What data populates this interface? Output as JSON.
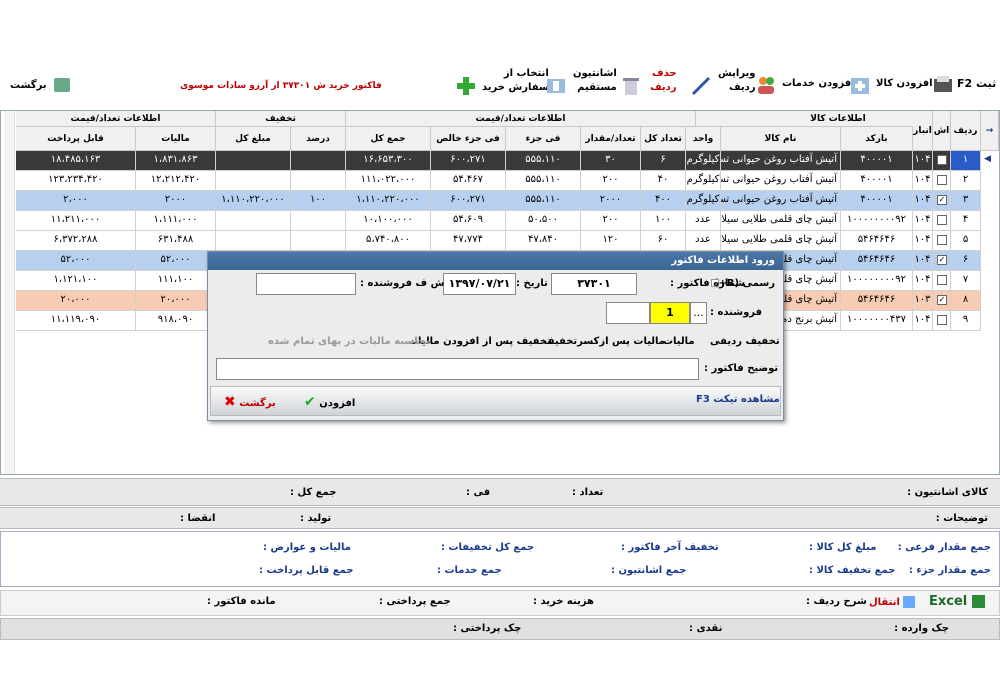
{
  "toolbar": {
    "back": "برگشت",
    "invoice_title": "فاکتور خرید ش ۳۷۳۰۱ از آرزو سادات موسوی",
    "select_from_order_1": "انتخاب از",
    "select_from_order_2": "سفارش خرید",
    "direct_asset_1": "اشانتیون",
    "direct_asset_2": "مستقیم",
    "delete_row_1": "حذف",
    "delete_row_2": "ردیف",
    "edit_row_1": "ویرایش",
    "edit_row_2": "ردیف",
    "add_services": "افزودن خدمات",
    "add_goods": "افزودن کالا",
    "register": "ثبت F2"
  },
  "grid": {
    "groups": {
      "product_info": "اطلاعات کالا",
      "qty_price": "اطلاعات تعداد/قیمت",
      "discount": "تخفیف",
      "qty_price2": "اطلاعات تعداد/قیمت"
    },
    "headers": {
      "row": "ردیف",
      "check": "اش",
      "store": "انبار",
      "barcode": "بارکد",
      "name": "نام کالا",
      "unit": "واحد",
      "qty_total": "تعداد کل",
      "qty": "تعداد/مقدار",
      "unit_price": "فی جزء",
      "net_price": "فی جزء خالص",
      "total": "جمع کل",
      "percent": "درصد",
      "disc_total": "مبلغ کل",
      "tax": "مالیات",
      "payable": "قابل پرداخت"
    },
    "rows": [
      {
        "row": "۱",
        "store": "۱۰۴",
        "barcode": "۴۰۰۰۰۱",
        "name": "آتیش آفتاب روغن حیوانی تست",
        "unit": "کیلوگرم",
        "qty_total": "۶",
        "qty": "۳۰",
        "unit_price": "۵۵۵،۱۱۰",
        "net_price": "۶۰۰،۲۷۱",
        "total": "۱۶،۶۵۳،۳۰۰",
        "percent": "",
        "disc_total": "",
        "tax": "۱،۸۳۱،۸۶۳",
        "payable": "۱۸،۴۸۵،۱۶۳",
        "checked": false
      },
      {
        "row": "۲",
        "store": "۱۰۴",
        "barcode": "۴۰۰۰۰۱",
        "name": "آتیش آفتاب روغن حیوانی تست",
        "unit": "کیلوگرم",
        "qty_total": "۴۰",
        "qty": "۲۰۰",
        "unit_price": "۵۵۵،۱۱۰",
        "net_price": "۵۴،۴۶۷",
        "total": "۱۱۱،۰۲۲،۰۰۰",
        "percent": "",
        "disc_total": "",
        "tax": "۱۲،۲۱۲،۴۲۰",
        "payable": "۱۲۳،۲۳۴،۴۲۰",
        "checked": false
      },
      {
        "row": "۳",
        "store": "۱۰۴",
        "barcode": "۴۰۰۰۰۱",
        "name": "آتیش آفتاب روغن حیوانی تست",
        "unit": "کیلوگرم",
        "qty_total": "۴۰۰",
        "qty": "۲۰۰۰",
        "unit_price": "۵۵۵،۱۱۰",
        "net_price": "۶۰۰،۲۷۱",
        "total": "۱،۱۱۰،۲۲۰،۰۰۰",
        "percent": "۱۰۰",
        "disc_total": "۱،۱۱۰،۲۲۰،۰۰۰",
        "tax": "۲۰۰۰",
        "payable": "۲،۰۰۰",
        "checked": true
      },
      {
        "row": "۴",
        "store": "۱۰۴",
        "barcode": "۱۰۰۰۰۰۰۰۰۹۲",
        "name": "آتیش چای قلمی طلایی سیلان",
        "unit": "عدد",
        "qty_total": "۱۰۰",
        "qty": "۲۰۰",
        "unit_price": "۵۰،۵۰۰",
        "net_price": "۵۴،۶۰۹",
        "total": "۱۰،۱۰۰،۰۰۰",
        "percent": "",
        "disc_total": "",
        "tax": "۱،۱۱۱،۰۰۰",
        "payable": "۱۱،۲۱۱،۰۰۰",
        "checked": false
      },
      {
        "row": "۵",
        "store": "۱۰۴",
        "barcode": "۵۴۶۴۶۴۶",
        "name": "آتیش چای قلمی طلایی سیلان پی",
        "unit": "عدد",
        "qty_total": "۶۰",
        "qty": "۱۲۰",
        "unit_price": "۴۷،۸۴۰",
        "net_price": "۴۷،۷۷۴",
        "total": "۵،۷۴۰،۸۰۰",
        "percent": "",
        "disc_total": "",
        "tax": "۶۳۱،۴۸۸",
        "payable": "۶،۳۷۲،۲۸۸",
        "checked": false
      },
      {
        "row": "۶",
        "store": "۱۰۴",
        "barcode": "۵۴۶۴۶۴۶",
        "name": "آتیش چای قلمی",
        "unit": "",
        "qty_total": "",
        "qty": "",
        "unit_price": "",
        "net_price": "",
        "total": "",
        "percent": "",
        "disc_total": "",
        "tax": "۵۲،۰۰۰",
        "payable": "۵۲،۰۰۰",
        "checked": true
      },
      {
        "row": "۷",
        "store": "۱۰۴",
        "barcode": "۱۰۰۰۰۰۰۰۰۹۲",
        "name": "آتیش چای قلمی",
        "unit": "",
        "qty_total": "",
        "qty": "",
        "unit_price": "",
        "net_price": "",
        "total": "",
        "percent": "",
        "disc_total": "",
        "tax": "۱۱۱،۱۰۰",
        "payable": "۱،۱۲۱،۱۰۰",
        "checked": false
      },
      {
        "row": "۸",
        "store": "۱۰۳",
        "barcode": "۵۴۶۴۶۴۶",
        "name": "آتیش چای قلمی",
        "unit": "",
        "qty_total": "",
        "qty": "",
        "unit_price": "",
        "net_price": "",
        "total": "",
        "percent": "",
        "disc_total": "",
        "tax": "۲۰،۰۰۰",
        "payable": "۲۰،۰۰۰",
        "checked": true
      },
      {
        "row": "۹",
        "store": "۱۰۴",
        "barcode": "۱۰۰۰۰۰۰۰۴۳۷",
        "name": "آتیش برنج دم",
        "unit": "",
        "qty_total": "",
        "qty": "",
        "unit_price": "",
        "net_price": "",
        "total": "",
        "percent": "",
        "disc_total": "",
        "tax": "۹۱۸،۰۹۰",
        "payable": "۱۱،۱۱۹،۰۹۰",
        "checked": false
      }
    ]
  },
  "dialog": {
    "title": "ورود اطلاعات فاکتور",
    "official": "رسمی (R+)",
    "invoice_no_label": "شماره فاکتور :",
    "invoice_no": "۳۷۳۰۱",
    "date_label": "تاریخ :",
    "date": "۱۳۹۷/۰۷/۲۱",
    "seller_invoice_label": "ش ف فروشنده :",
    "seller_invoice": "",
    "seller_label": "فروشنده :",
    "seller_code": "1",
    "seller_more": "...",
    "opt_row_discount": "تخفیف ردیفی",
    "opt_tax": "مالیات",
    "opt_tax_after": "مالیات پس ازکسرتخفیف",
    "opt_discount_after_tax": "تخفیف پس از افزودن مالیات",
    "opt_tax_in_cost": "محاسبه مالیات در بهای تمام شده",
    "description_label": "توضیح فاکتور :",
    "description": "",
    "view_ticket": "مشاهده تیکت F3",
    "add": "افزودن",
    "back": "برگشت"
  },
  "bottom": {
    "asset_goods": "کالای اشانتیون :",
    "qty": "تعداد :",
    "unit_price": "فی :",
    "total": "جمع کل :",
    "notes": "توضیحات :",
    "production": "تولید :",
    "expiry": "انقضا :",
    "sum_sub_qty": "جمع مقدار فرعی :",
    "total_goods_amount": "مبلغ کل کالا :",
    "last_discount": "تخفیف آخر فاکتور :",
    "total_discounts": "جمع کل تخفیفات :",
    "tax_duties": "مالیات و عوارض :",
    "sum_part_qty": "جمع مقدار جزء :",
    "goods_discount_total": "جمع تخفیف کالا :",
    "sum_asset": "جمع اشانتیون :",
    "sum_services": "جمع خدمات :",
    "sum_payable": "جمع قابل پرداخت :",
    "excel": "Excel",
    "transfer": "انتقال",
    "row_desc": "شرح ردیف :",
    "purchase_cost": "هزینه خرید :",
    "sum_paid": "جمع پرداختی :",
    "invoice_remain": "مانده فاکتور :",
    "cheque_in": "چک وارده :",
    "cash": "نقدی :",
    "cheque_out": "چک پرداختی :"
  }
}
